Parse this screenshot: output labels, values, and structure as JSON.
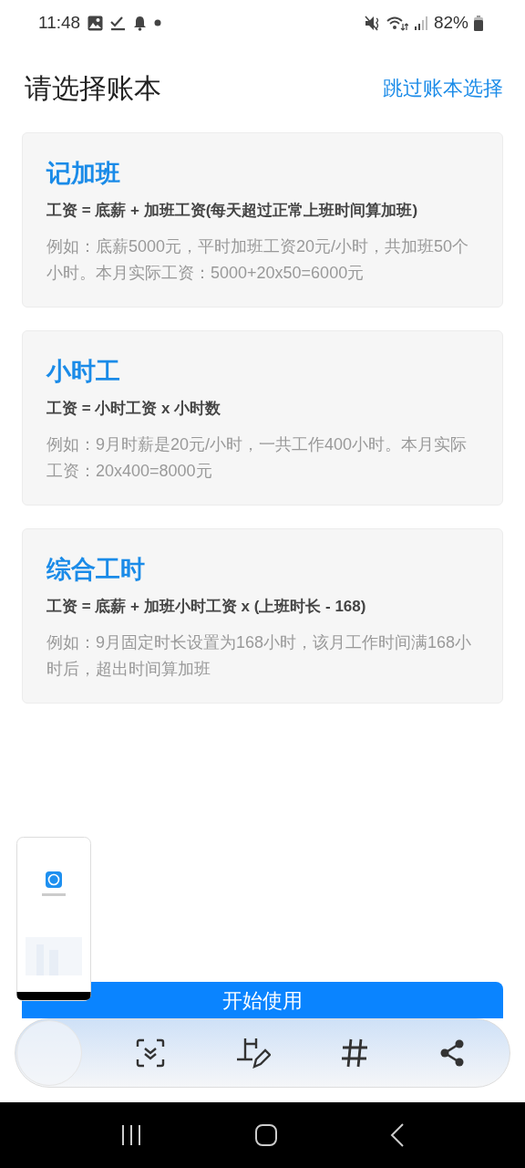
{
  "status_bar": {
    "time": "11:48",
    "battery": "82%"
  },
  "header": {
    "title": "请选择账本",
    "skip_link": "跳过账本选择"
  },
  "cards": [
    {
      "title": "记加班",
      "formula": "工资 = 底薪 + 加班工资(每天超过正常上班时间算加班)",
      "example": "例如：底薪5000元，平时加班工资20元/小时，共加班50个小时。本月实际工资：5000+20x50=6000元"
    },
    {
      "title": "小时工",
      "formula": "工资 = 小时工资 x 小时数",
      "example": "例如：9月时薪是20元/小时，一共工作400小时。本月实际工资：20x400=8000元"
    },
    {
      "title": "综合工时",
      "formula": "工资 = 底薪 + 加班小时工资 x (上班时长 - 168)",
      "example": "例如：9月固定时长设置为168小时，该月工作时间满168小时后，超出时间算加班"
    }
  ],
  "start_button": "开始使用"
}
